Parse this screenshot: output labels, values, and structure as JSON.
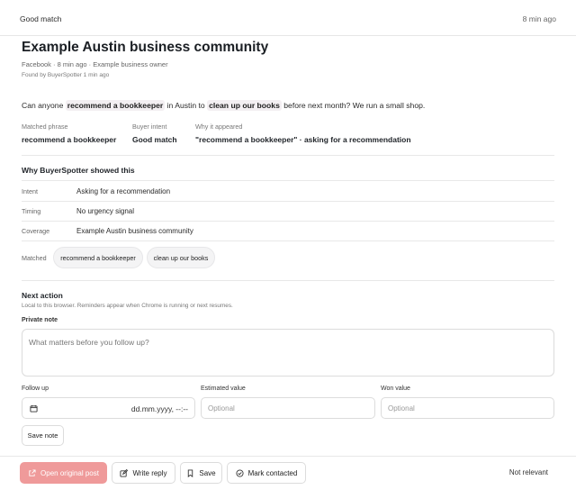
{
  "header": {
    "match_label": "Good match",
    "time": "8 min ago"
  },
  "post": {
    "title": "Example Austin business community",
    "meta": "Facebook · 8 min ago · Example business owner",
    "found": "Found by BuyerSpotter 1 min ago",
    "text_1": "Can anyone ",
    "highlight_1": "recommend a bookkeeper",
    "text_2": " in Austin to ",
    "highlight_2": "clean up our books",
    "text_3": " before next month? We run a small shop."
  },
  "summary": {
    "matched_phrase_label": "Matched phrase",
    "matched_phrase_value": "recommend a bookkeeper",
    "buyer_intent_label": "Buyer intent",
    "buyer_intent_value": "Good match",
    "why_label": "Why it appeared",
    "why_value": "\"recommend a bookkeeper\" · asking for a recommendation"
  },
  "why": {
    "title": "Why BuyerSpotter showed this",
    "rows": [
      {
        "key": "Intent",
        "value": "Asking for a recommendation"
      },
      {
        "key": "Timing",
        "value": "No urgency signal"
      },
      {
        "key": "Coverage",
        "value": "Example Austin business community"
      }
    ],
    "matched_label": "Matched",
    "chips": [
      "recommend a bookkeeper",
      "clean up our books"
    ]
  },
  "next_action": {
    "title": "Next action",
    "subtitle": "Local to this browser. Reminders appear when Chrome is running or next resumes.",
    "private_note_label": "Private note",
    "private_note_placeholder": "What matters before you follow up?",
    "follow_up_label": "Follow up",
    "follow_up_value": "dd.mm.yyyy, --:--",
    "estimated_value_label": "Estimated value",
    "estimated_value_placeholder": "Optional",
    "won_value_label": "Won value",
    "won_value_placeholder": "Optional",
    "save_note_label": "Save note"
  },
  "actions": {
    "open_original": "Open original post",
    "write_reply": "Write reply",
    "save": "Save",
    "mark_contacted": "Mark contacted",
    "not_relevant": "Not relevant"
  },
  "colors": {
    "primary_disabled": "#ef9a9a",
    "highlight_bg": "#f3eff2"
  },
  "icons": {
    "open_original": "external-link-icon",
    "write_reply": "edit-icon",
    "save": "bookmark-icon",
    "mark_contacted": "check-circle-icon",
    "follow_up": "calendar-icon"
  }
}
